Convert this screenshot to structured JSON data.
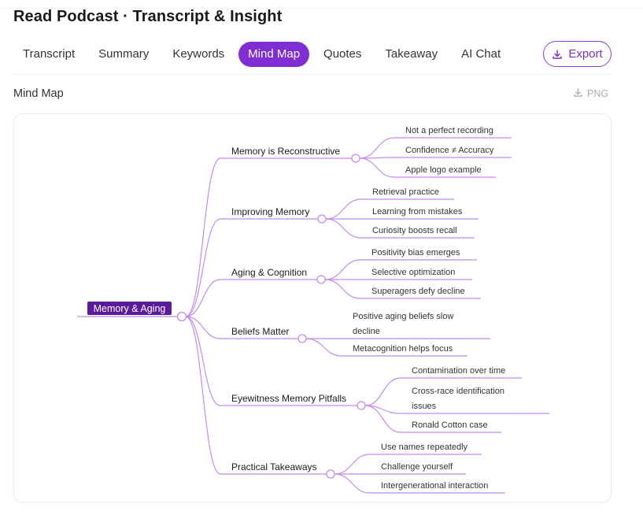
{
  "header": {
    "title": "Read Podcast · Transcript & Insight"
  },
  "tabs": [
    {
      "label": "Transcript",
      "active": false
    },
    {
      "label": "Summary",
      "active": false
    },
    {
      "label": "Keywords",
      "active": false
    },
    {
      "label": "Mind Map",
      "active": true
    },
    {
      "label": "Quotes",
      "active": false
    },
    {
      "label": "Takeaway",
      "active": false
    },
    {
      "label": "AI Chat",
      "active": false
    }
  ],
  "export_button": {
    "label": "Export",
    "icon": "download-icon"
  },
  "section": {
    "title": "Mind Map",
    "png_label": "PNG",
    "png_icon": "download-icon"
  },
  "colors": {
    "accent": "#7f2ed3",
    "edge": "#c58af0",
    "root_bg": "#5b1a9a"
  },
  "mindmap": {
    "root": "Memory & Aging",
    "branches": [
      {
        "label": "Memory is Reconstructive",
        "children": [
          [
            "Not a perfect recording"
          ],
          [
            "Confidence ≠ Accuracy"
          ],
          [
            "Apple logo example"
          ]
        ]
      },
      {
        "label": "Improving Memory",
        "children": [
          [
            "Retrieval practice"
          ],
          [
            "Learning from mistakes"
          ],
          [
            "Curiosity boosts recall"
          ]
        ]
      },
      {
        "label": "Aging & Cognition",
        "children": [
          [
            "Positivity bias emerges"
          ],
          [
            "Selective optimization"
          ],
          [
            "Superagers defy decline"
          ]
        ]
      },
      {
        "label": "Beliefs Matter",
        "children": [
          [
            "Positive aging beliefs slow",
            "decline"
          ],
          [
            "Metacognition helps focus"
          ]
        ]
      },
      {
        "label": "Eyewitness Memory Pitfalls",
        "children": [
          [
            "Contamination over time"
          ],
          [
            "Cross-race identification",
            "issues"
          ],
          [
            "Ronald Cotton case"
          ]
        ]
      },
      {
        "label": "Practical Takeaways",
        "children": [
          [
            "Use names repeatedly"
          ],
          [
            "Challenge yourself"
          ],
          [
            "Intergenerational interaction"
          ]
        ]
      }
    ]
  }
}
